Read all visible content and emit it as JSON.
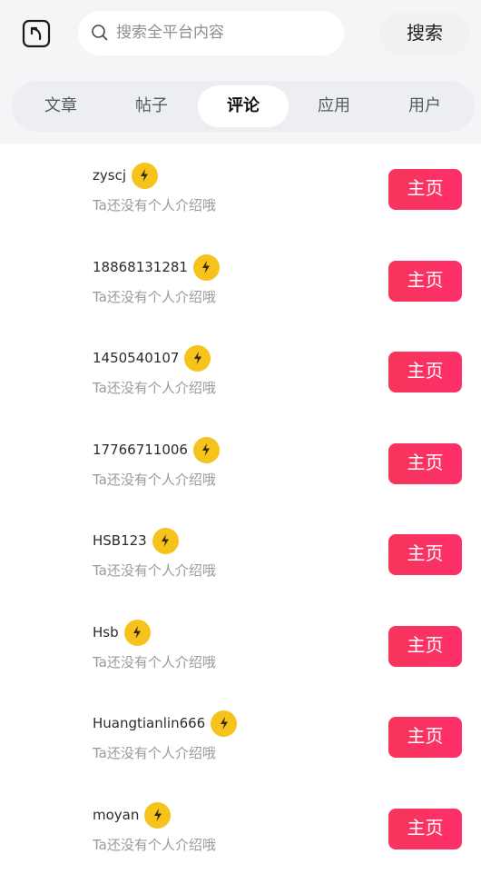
{
  "search": {
    "placeholder": "搜索全平台内容",
    "button_label": "搜索"
  },
  "tabs": [
    {
      "label": "文章"
    },
    {
      "label": "帖子"
    },
    {
      "label": "评论"
    },
    {
      "label": "应用"
    },
    {
      "label": "用户"
    }
  ],
  "active_tab_index": 2,
  "users": [
    {
      "name": "zyscj",
      "bio": "Ta还没有个人介绍哦",
      "button": "主页"
    },
    {
      "name": "18868131281",
      "bio": "Ta还没有个人介绍哦",
      "button": "主页"
    },
    {
      "name": "1450540107",
      "bio": "Ta还没有个人介绍哦",
      "button": "主页"
    },
    {
      "name": "17766711006",
      "bio": "Ta还没有个人介绍哦",
      "button": "主页"
    },
    {
      "name": "HSB123",
      "bio": "Ta还没有个人介绍哦",
      "button": "主页"
    },
    {
      "name": "Hsb",
      "bio": "Ta还没有个人介绍哦",
      "button": "主页"
    },
    {
      "name": "Huangtianlin666",
      "bio": "Ta还没有个人介绍哦",
      "button": "主页"
    },
    {
      "name": "moyan",
      "bio": "Ta还没有个人介绍哦",
      "button": "主页"
    }
  ],
  "colors": {
    "accent": "#f5355a",
    "badge": "#f6c31c",
    "header_bg": "#f4f5f7"
  },
  "icons": {
    "back": "back-arrow-icon",
    "search": "search-icon",
    "badge": "lightning-icon"
  }
}
